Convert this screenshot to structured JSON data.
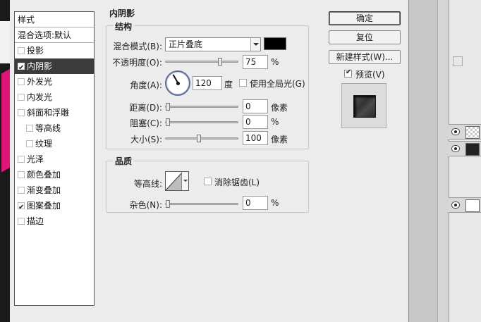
{
  "styles_panel": {
    "header": "样式",
    "blend_options": "混合选项:默认",
    "items": [
      {
        "label": "投影",
        "checked": false,
        "indent": false
      },
      {
        "label": "内阴影",
        "checked": true,
        "indent": false,
        "selected": true
      },
      {
        "label": "外发光",
        "checked": false,
        "indent": false
      },
      {
        "label": "内发光",
        "checked": false,
        "indent": false
      },
      {
        "label": "斜面和浮雕",
        "checked": false,
        "indent": false
      },
      {
        "label": "等高线",
        "checked": false,
        "indent": true
      },
      {
        "label": "纹理",
        "checked": false,
        "indent": true
      },
      {
        "label": "光泽",
        "checked": false,
        "indent": false
      },
      {
        "label": "颜色叠加",
        "checked": false,
        "indent": false
      },
      {
        "label": "渐变叠加",
        "checked": false,
        "indent": false
      },
      {
        "label": "图案叠加",
        "checked": true,
        "indent": false
      },
      {
        "label": "描边",
        "checked": false,
        "indent": false
      }
    ]
  },
  "inner_shadow": {
    "title": "内阴影",
    "structure": {
      "title": "结构",
      "blend_mode_label": "混合模式(B):",
      "blend_mode_value": "正片叠底",
      "shadow_color": "#000000",
      "opacity_label": "不透明度(O):",
      "opacity_value": "75",
      "opacity_unit": "%",
      "angle_label": "角度(A):",
      "angle_value": "120",
      "angle_unit": "度",
      "global_light_label": "使用全局光(G)",
      "global_light_checked": false,
      "distance_label": "距离(D):",
      "distance_value": "0",
      "distance_unit": "像素",
      "choke_label": "阻塞(C):",
      "choke_value": "0",
      "choke_unit": "%",
      "size_label": "大小(S):",
      "size_value": "100",
      "size_unit": "像素"
    },
    "quality": {
      "title": "品质",
      "contour_label": "等高线:",
      "antialias_label": "消除锯齿(L)",
      "antialias_checked": false,
      "noise_label": "杂色(N):",
      "noise_value": "0",
      "noise_unit": "%"
    }
  },
  "buttons": {
    "ok": "确定",
    "reset": "复位",
    "new_style": "新建样式(W)...",
    "preview_label": "预览(V)",
    "preview_checked": true
  }
}
